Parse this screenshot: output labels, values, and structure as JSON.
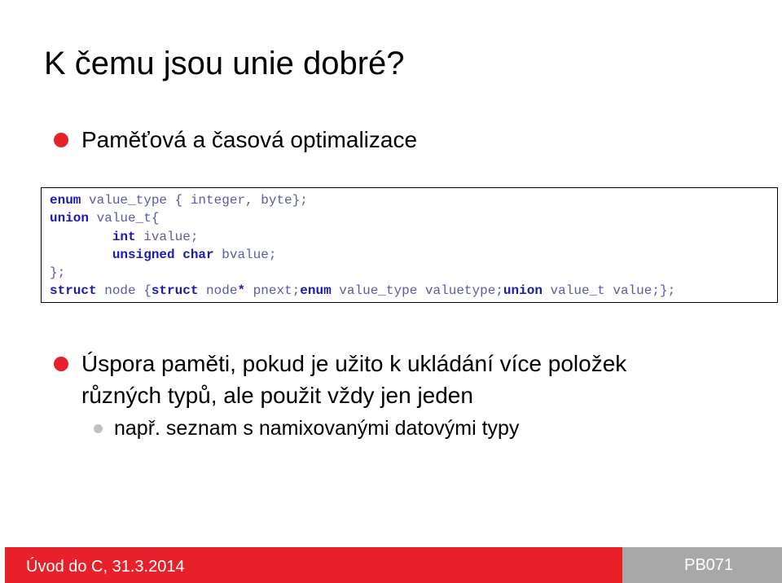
{
  "slide": {
    "title": "K čemu jsou unie dobré?",
    "accent_color": "#e8202a",
    "bullet1": "Paměťová a časová optimalizace",
    "bullet2_line1": "Úspora paměti, pokud je užito k ukládání více položek",
    "bullet2_line2": "různých typů, ale použit vždy jen jeden",
    "sub_bullet": "např. seznam s namixovanými datovými typy"
  },
  "code": {
    "keyword_color": "#1a1ab0",
    "text_color": "#5a5aa6",
    "lines": [
      [
        {
          "text": "enum",
          "kind": "kw"
        },
        {
          "text": " value_type { integer, byte};",
          "kind": "ty"
        }
      ],
      [
        {
          "text": "union",
          "kind": "kw"
        },
        {
          "text": " value_t{",
          "kind": "ty"
        }
      ],
      [
        {
          "text": "        ",
          "kind": "ty"
        },
        {
          "text": "int",
          "kind": "kw"
        },
        {
          "text": " ivalue;",
          "kind": "ty"
        }
      ],
      [
        {
          "text": "        ",
          "kind": "ty"
        },
        {
          "text": "unsigned char",
          "kind": "kw"
        },
        {
          "text": " bvalue;",
          "kind": "ty"
        }
      ],
      [
        {
          "text": "};",
          "kind": "ty"
        }
      ],
      [
        {
          "text": "struct",
          "kind": "kw"
        },
        {
          "text": " node {",
          "kind": "ty"
        },
        {
          "text": "struct",
          "kind": "kw"
        },
        {
          "text": " node",
          "kind": "ty"
        },
        {
          "text": "*",
          "kind": "kw"
        },
        {
          "text": " pnext;",
          "kind": "ty"
        },
        {
          "text": "enum",
          "kind": "kw"
        },
        {
          "text": " value_type valuetype;",
          "kind": "ty"
        },
        {
          "text": "union",
          "kind": "kw"
        },
        {
          "text": " value_t value;};",
          "kind": "ty"
        }
      ]
    ]
  },
  "footer": {
    "left_text": "Úvod do C, 31.3.2014",
    "right_text": "PB071",
    "left_color": "#e8202a",
    "right_color": "#a8a8a8"
  },
  "sub_bullet_color": "#c0c0c0"
}
